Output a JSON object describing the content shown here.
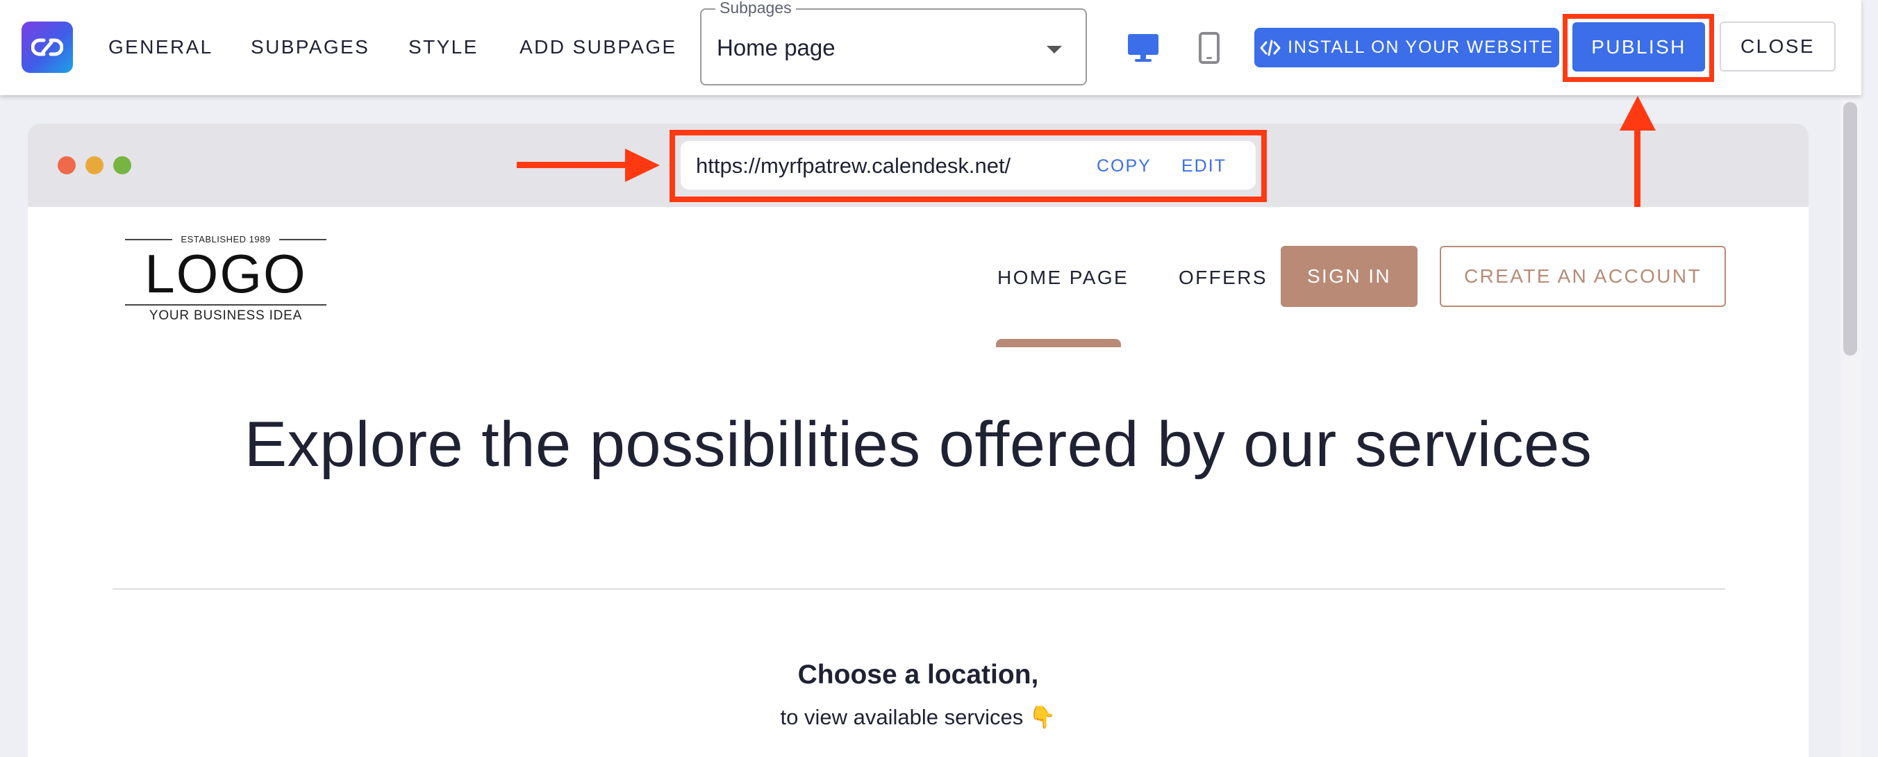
{
  "toolbar": {
    "tabs": [
      {
        "label": "GENERAL"
      },
      {
        "label": "SUBPAGES"
      },
      {
        "label": "STYLE"
      },
      {
        "label": "ADD SUBPAGE"
      }
    ],
    "subpages_select": {
      "label": "Subpages",
      "value": "Home page"
    },
    "install_label": "INSTALL ON YOUR WEBSITE",
    "publish_label": "PUBLISH",
    "close_label": "CLOSE",
    "accent_color": "#3b6ee8",
    "highlight_color": "#ff3a12"
  },
  "browser": {
    "url": "https://myrfpatrew.calendesk.net/",
    "copy_label": "COPY",
    "edit_label": "EDIT",
    "window_dots": [
      "#ee6a4a",
      "#e9a93a",
      "#77b543"
    ]
  },
  "site": {
    "logo": {
      "established": "ESTABLISHED 1989",
      "word": "LOGO",
      "tagline": "YOUR BUSINESS IDEA"
    },
    "nav": {
      "home": "HOME PAGE",
      "offers": "OFFERS",
      "sign_in": "SIGN IN",
      "create_account": "CREATE AN ACCOUNT"
    },
    "brand_color": "#b98a76",
    "hero_title": "Explore the possibilities offered by our services",
    "location_title": "Choose a location,",
    "location_subtitle": "to view available services 👇"
  }
}
